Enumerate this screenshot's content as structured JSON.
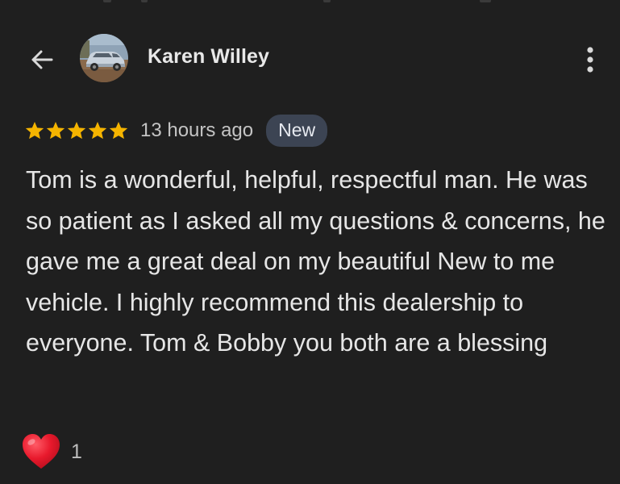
{
  "reviewer": {
    "name": "Karen Willey"
  },
  "review": {
    "rating": 5,
    "max_rating": 5,
    "timestamp": "13 hours ago",
    "badge": "New",
    "text": "Tom is a wonderful, helpful, respectful man. He was so patient as I asked all my questions & concerns, he gave me a great deal on my beautiful New to me vehicle. I highly recommend this dealership to everyone. Tom & Bobby you both are a blessing"
  },
  "reactions": {
    "icon": "heart-icon",
    "count": "1"
  },
  "colors": {
    "background": "#1f1f1f",
    "star": "#f5b400",
    "heart": "#e8192c",
    "badge_bg": "#3c4453"
  }
}
